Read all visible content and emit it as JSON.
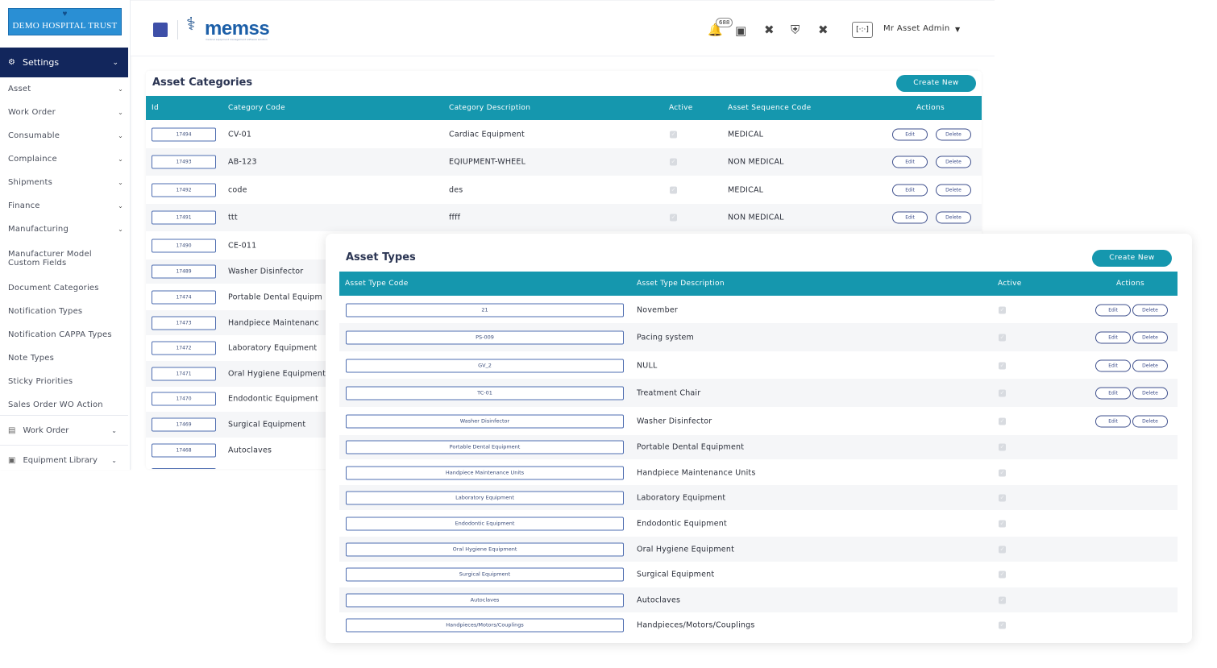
{
  "org_logo_text": "DEMO HOSPITAL TRUST",
  "brand": {
    "name": "memss",
    "tagline": "medical equipment management software solution"
  },
  "header": {
    "notification_count": "688",
    "user_name": "Mr Asset Admin",
    "avatar_text": "[·:·]"
  },
  "sidebar": {
    "section_label": "Settings",
    "items": [
      {
        "label": "Asset",
        "chevron": true
      },
      {
        "label": "Work Order",
        "chevron": true
      },
      {
        "label": "Consumable",
        "chevron": true
      },
      {
        "label": "Complaince",
        "chevron": true
      },
      {
        "label": "Shipments",
        "chevron": true
      },
      {
        "label": "Finance",
        "chevron": true
      },
      {
        "label": "Manufacturing",
        "chevron": true
      },
      {
        "label": "Manufacturer Model Custom Fields",
        "chevron": false
      },
      {
        "label": "Document Categories",
        "chevron": false
      },
      {
        "label": "Notification Types",
        "chevron": false
      },
      {
        "label": "Notification CAPPA Types",
        "chevron": false
      },
      {
        "label": "Note Types",
        "chevron": false
      },
      {
        "label": "Sticky Priorities",
        "chevron": false
      },
      {
        "label": "Sales Order WO Action",
        "chevron": false
      }
    ],
    "sections": [
      {
        "label": "Work Order"
      },
      {
        "label": "Equipment Library"
      }
    ]
  },
  "categories": {
    "title": "Asset Categories",
    "create_label": "Create New",
    "columns": {
      "id": "Id",
      "code": "Category Code",
      "desc": "Category Description",
      "active": "Active",
      "seq": "Asset Sequence Code",
      "actions": "Actions"
    },
    "rows": [
      {
        "id": "17494",
        "code": "CV-01",
        "desc": "Cardiac Equipment",
        "active": true,
        "seq": "MEDICAL",
        "actions": true
      },
      {
        "id": "17493",
        "code": "AB-123",
        "desc": "EQIUPMENT-WHEEL",
        "active": true,
        "seq": "NON MEDICAL",
        "actions": true
      },
      {
        "id": "17492",
        "code": "code",
        "desc": "des",
        "active": true,
        "seq": "MEDICAL",
        "actions": true
      },
      {
        "id": "17491",
        "code": "ttt",
        "desc": "ffff",
        "active": true,
        "seq": "NON MEDICAL",
        "actions": true
      },
      {
        "id": "17490",
        "code": "CE-011",
        "desc": "",
        "active": false,
        "seq": "",
        "actions": false
      },
      {
        "id": "17489",
        "code": "Washer Disinfector",
        "desc": "",
        "active": false,
        "seq": "",
        "actions": false
      },
      {
        "id": "17474",
        "code": "Portable Dental Equipm",
        "desc": "",
        "active": false,
        "seq": "",
        "actions": false
      },
      {
        "id": "17473",
        "code": "Handpiece Maintenanc",
        "desc": "",
        "active": false,
        "seq": "",
        "actions": false
      },
      {
        "id": "17472",
        "code": "Laboratory Equipment",
        "desc": "",
        "active": false,
        "seq": "",
        "actions": false
      },
      {
        "id": "17471",
        "code": "Oral Hygiene Equipment",
        "desc": "",
        "active": false,
        "seq": "",
        "actions": false
      },
      {
        "id": "17470",
        "code": "Endodontic Equipment",
        "desc": "",
        "active": false,
        "seq": "",
        "actions": false
      },
      {
        "id": "17469",
        "code": "Surgical Equipment",
        "desc": "",
        "active": false,
        "seq": "",
        "actions": false
      },
      {
        "id": "17468",
        "code": "Autoclaves",
        "desc": "",
        "active": false,
        "seq": "",
        "actions": false
      }
    ],
    "edit_label": "Edit",
    "delete_label": "Delete"
  },
  "types": {
    "title": "Asset Types",
    "create_label": "Create New",
    "columns": {
      "code": "Asset Type Code",
      "desc": "Asset Type Description",
      "active": "Active",
      "actions": "Actions"
    },
    "rows": [
      {
        "code": "21",
        "desc": "November",
        "active": true,
        "actions": true
      },
      {
        "code": "PS-009",
        "desc": "Pacing system",
        "active": true,
        "actions": true
      },
      {
        "code": "GV_2",
        "desc": "NULL",
        "active": true,
        "actions": true
      },
      {
        "code": "TC-01",
        "desc": "Treatment Chair",
        "active": true,
        "actions": true
      },
      {
        "code": "Washer Disinfector",
        "desc": "Washer Disinfector",
        "active": true,
        "actions": true
      },
      {
        "code": "Portable Dental Equipment",
        "desc": "Portable Dental Equipment",
        "active": true,
        "actions": false
      },
      {
        "code": "Handpiece Maintenance Units",
        "desc": "Handpiece Maintenance Units",
        "active": true,
        "actions": false
      },
      {
        "code": "Laboratory Equipment",
        "desc": "Laboratory Equipment",
        "active": true,
        "actions": false
      },
      {
        "code": "Endodontic Equipment",
        "desc": "Endodontic Equipment",
        "active": true,
        "actions": false
      },
      {
        "code": "Oral Hygiene Equipment",
        "desc": "Oral Hygiene Equipment",
        "active": true,
        "actions": false
      },
      {
        "code": "Surgical Equipment",
        "desc": "Surgical Equipment",
        "active": true,
        "actions": false
      },
      {
        "code": "Autoclaves",
        "desc": "Autoclaves",
        "active": true,
        "actions": false
      },
      {
        "code": "Handpieces/Motors/Couplings",
        "desc": "Handpieces/Motors/Couplings",
        "active": true,
        "actions": false
      }
    ],
    "edit_label": "Edit",
    "delete_label": "Delete"
  },
  "colors": {
    "accent": "#1597ae",
    "sidebar_active": "#12265c",
    "outline": "#3e4f8c"
  }
}
